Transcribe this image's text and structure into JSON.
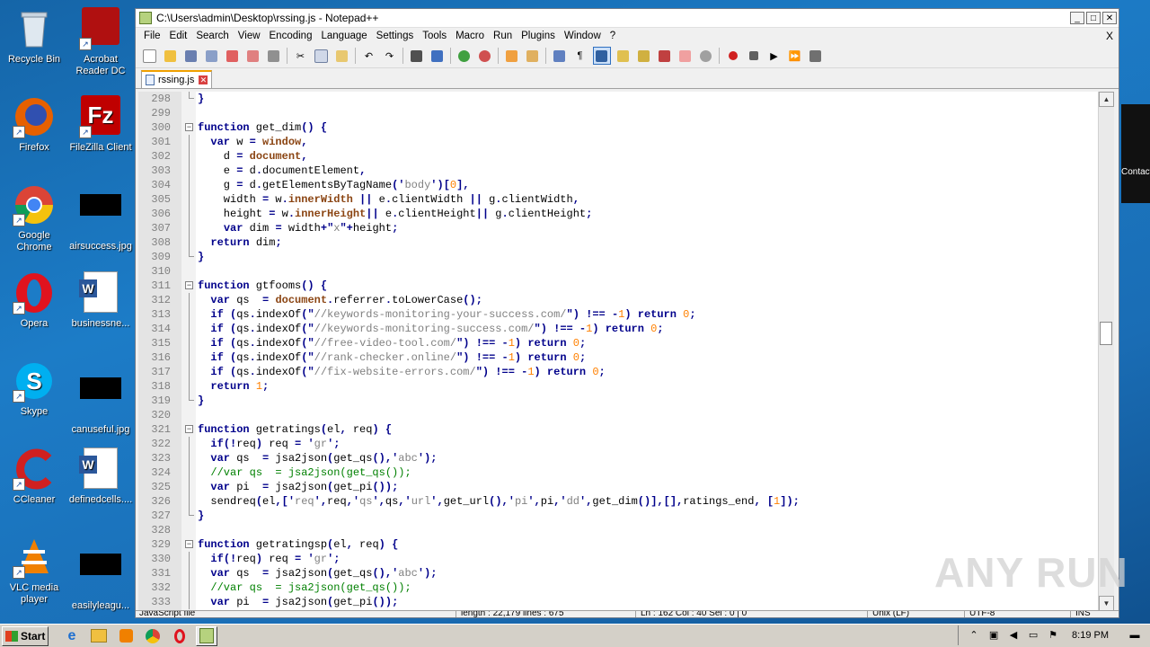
{
  "desktop": {
    "icons": [
      {
        "label": "Recycle Bin"
      },
      {
        "label": "Acrobat Reader DC"
      },
      {
        "label": "Firefox"
      },
      {
        "label": "FileZilla Client"
      },
      {
        "label": "Google Chrome"
      },
      {
        "label": "airsuccess.jpg"
      },
      {
        "label": "Opera"
      },
      {
        "label": "businessne..."
      },
      {
        "label": "Skype"
      },
      {
        "label": "canuseful.jpg"
      },
      {
        "label": "CCleaner"
      },
      {
        "label": "definedcells...."
      },
      {
        "label": "VLC media player"
      },
      {
        "label": "easilyleagu..."
      }
    ],
    "peek_text": "Contact"
  },
  "window": {
    "title": "C:\\Users\\admin\\Desktop\\rssing.js - Notepad++",
    "menu": [
      "File",
      "Edit",
      "Search",
      "View",
      "Encoding",
      "Language",
      "Settings",
      "Tools",
      "Macro",
      "Run",
      "Plugins",
      "Window",
      "?"
    ],
    "menu_close": "X",
    "tab_label": "rssing.js",
    "status": {
      "left": "JavaScript file",
      "length": "length : 22,179  lines : 675",
      "position": "Ln : 162   Col : 40   Sel : 0 | 0",
      "eol": "Unix (LF)",
      "encoding": "UTF-8",
      "mode": "INS"
    }
  },
  "code_lines": [
    {
      "n": "298",
      "t": "}"
    },
    {
      "n": "299",
      "t": ""
    },
    {
      "n": "300",
      "t": "function get_dim() {"
    },
    {
      "n": "301",
      "t": "  var w = window,"
    },
    {
      "n": "302",
      "t": "    d = document,"
    },
    {
      "n": "303",
      "t": "    e = d.documentElement,"
    },
    {
      "n": "304",
      "t": "    g = d.getElementsByTagName('body')[0],"
    },
    {
      "n": "305",
      "t": "    width = w.innerWidth || e.clientWidth || g.clientWidth,"
    },
    {
      "n": "306",
      "t": "    height = w.innerHeight|| e.clientHeight|| g.clientHeight;"
    },
    {
      "n": "307",
      "t": "    var dim = width+\"x\"+height;"
    },
    {
      "n": "308",
      "t": "  return dim;"
    },
    {
      "n": "309",
      "t": "}"
    },
    {
      "n": "310",
      "t": ""
    },
    {
      "n": "311",
      "t": "function gtfooms() {"
    },
    {
      "n": "312",
      "t": "  var qs  = document.referrer.toLowerCase();"
    },
    {
      "n": "313",
      "t": "  if (qs.indexOf(\"//keywords-monitoring-your-success.com/\") !== -1) return 0;"
    },
    {
      "n": "314",
      "t": "  if (qs.indexOf(\"//keywords-monitoring-success.com/\") !== -1) return 0;"
    },
    {
      "n": "315",
      "t": "  if (qs.indexOf(\"//free-video-tool.com/\") !== -1) return 0;"
    },
    {
      "n": "316",
      "t": "  if (qs.indexOf(\"//rank-checker.online/\") !== -1) return 0;"
    },
    {
      "n": "317",
      "t": "  if (qs.indexOf(\"//fix-website-errors.com/\") !== -1) return 0;"
    },
    {
      "n": "318",
      "t": "  return 1;"
    },
    {
      "n": "319",
      "t": "}"
    },
    {
      "n": "320",
      "t": ""
    },
    {
      "n": "321",
      "t": "function getratings(el, req) {"
    },
    {
      "n": "322",
      "t": "  if(!req) req = 'gr';"
    },
    {
      "n": "323",
      "t": "  var qs  = jsa2json(get_qs(),'abc');"
    },
    {
      "n": "324",
      "t": "  //var qs  = jsa2json(get_qs());"
    },
    {
      "n": "325",
      "t": "  var pi  = jsa2json(get_pi());"
    },
    {
      "n": "326",
      "t": "  sendreq(el,['req',req,'qs',qs,'url',get_url(),'pi',pi,'dd',get_dim()],[],ratings_end, [1]);"
    },
    {
      "n": "327",
      "t": "}"
    },
    {
      "n": "328",
      "t": ""
    },
    {
      "n": "329",
      "t": "function getratingsp(el, req) {"
    },
    {
      "n": "330",
      "t": "  if(!req) req = 'gr';"
    },
    {
      "n": "331",
      "t": "  var qs  = jsa2json(get_qs(),'abc');"
    },
    {
      "n": "332",
      "t": "  //var qs  = jsa2json(get_qs());"
    },
    {
      "n": "333",
      "t": "  var pi  = jsa2json(get_pi());"
    }
  ],
  "taskbar": {
    "start_label": "Start",
    "clock": "8:19 PM"
  },
  "watermark": "ANY RUN",
  "colors": {
    "keyword": "#00008b",
    "builtin": "#8b4513",
    "string": "#808080",
    "number": "#ff8000",
    "comment": "#008000"
  }
}
